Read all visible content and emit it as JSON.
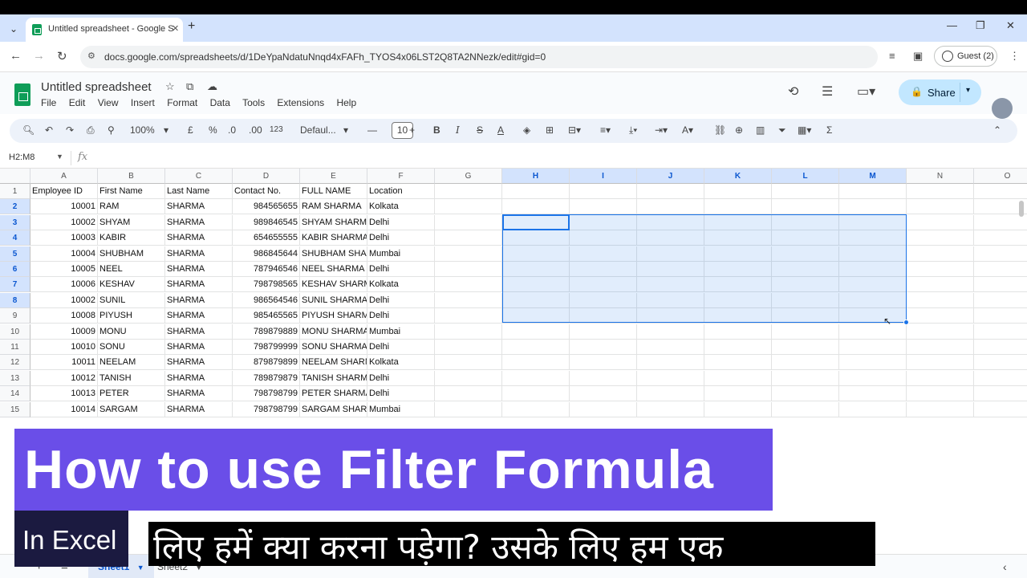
{
  "browser": {
    "tab_title": "Untitled spreadsheet - Google S",
    "url": "docs.google.com/spreadsheets/d/1DeYpaNdatuNnqd4xFAFh_TYOS4x06LST2Q8TA2NNezk/edit#gid=0",
    "guest_label": "Guest (2)"
  },
  "doc": {
    "title": "Untitled spreadsheet",
    "menus": [
      "File",
      "Edit",
      "View",
      "Insert",
      "Format",
      "Data",
      "Tools",
      "Extensions",
      "Help"
    ],
    "share_label": "Share"
  },
  "toolbar": {
    "zoom": "100%",
    "currency": "£",
    "percent": "%",
    "dec_minus": ".0",
    "dec_plus": ".00",
    "number_format": "123",
    "font": "Defaul...",
    "font_size": "10"
  },
  "formula_bar": {
    "name_box": "H2:M8",
    "fx": "fx"
  },
  "grid": {
    "columns": [
      "A",
      "B",
      "C",
      "D",
      "E",
      "F",
      "G",
      "H",
      "I",
      "J",
      "K",
      "L",
      "M",
      "N",
      "O"
    ],
    "row_numbers": [
      "1",
      "2",
      "3",
      "4",
      "5",
      "6",
      "7",
      "8",
      "9",
      "10",
      "11",
      "12",
      "13",
      "14",
      "15"
    ],
    "headers": [
      "Employee ID",
      "First Name",
      "Last Name",
      "Contact No.",
      "FULL NAME",
      "Location"
    ],
    "rows": [
      [
        "10001",
        "RAM",
        "SHARMA",
        "984565655",
        "RAM SHARMA",
        "Kolkata"
      ],
      [
        "10002",
        "SHYAM",
        "SHARMA",
        "989846545",
        "SHYAM SHARMA",
        "Delhi"
      ],
      [
        "10003",
        "KABIR",
        "SHARMA",
        "654655555",
        "KABIR SHARMA",
        "Delhi"
      ],
      [
        "10004",
        "SHUBHAM",
        "SHARMA",
        "986845644",
        "SHUBHAM SHARMA",
        "Mumbai"
      ],
      [
        "10005",
        "NEEL",
        "SHARMA",
        "787946546",
        "NEEL SHARMA",
        "Delhi"
      ],
      [
        "10006",
        "KESHAV",
        "SHARMA",
        "798798565",
        "KESHAV SHARMA",
        "Kolkata"
      ],
      [
        "10002",
        "SUNIL",
        "SHARMA",
        "986564546",
        "SUNIL SHARMA",
        "Delhi"
      ],
      [
        "10008",
        "PIYUSH",
        "SHARMA",
        "985465565",
        "PIYUSH SHARMA",
        "Delhi"
      ],
      [
        "10009",
        "MONU",
        "SHARMA",
        "789879889",
        "MONU SHARMA",
        "Mumbai"
      ],
      [
        "10010",
        "SONU",
        "SHARMA",
        "798799999",
        "SONU SHARMA",
        "Delhi"
      ],
      [
        "10011",
        "NEELAM",
        "SHARMA",
        "879879899",
        "NEELAM SHARMA",
        "Kolkata"
      ],
      [
        "10012",
        "TANISH",
        "SHARMA",
        "789879879",
        "TANISH SHARMA",
        "Delhi"
      ],
      [
        "10013",
        "PETER",
        "SHARMA",
        "798798799",
        "PETER SHARMA",
        "Delhi"
      ],
      [
        "10014",
        "SARGAM",
        "SHARMA",
        "798798799",
        "SARGAM SHARMA",
        "Mumbai"
      ]
    ]
  },
  "sheets": [
    "Sheet1",
    "Sheet2"
  ],
  "overlay": {
    "banner": "How to use Filter Formula",
    "badge": "In Excel",
    "subtitle": "लिए हमें क्या करना पड़ेगा? उसके लिए हम एक"
  },
  "colors": {
    "accent": "#1a73e8",
    "banner_bg": "#6a4ee8",
    "badge_bg": "#1b1a40",
    "sheets_green": "#0f9d58"
  }
}
